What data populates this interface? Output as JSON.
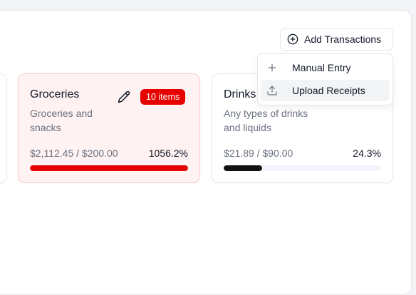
{
  "header": {
    "add_transactions_label": "Add Transactions",
    "add_icon": "plus-circle-icon"
  },
  "dropdown": {
    "items": [
      {
        "label": "Manual Entry",
        "icon": "plus-icon"
      },
      {
        "label": "Upload Receipts",
        "icon": "upload-icon",
        "highlighted": true
      }
    ]
  },
  "categories": [
    {
      "title": "Groceries",
      "description": "Groceries and snacks",
      "badge": "10 items",
      "amount": "$2,112.45 / $200.00",
      "percent_label": "1056.2%",
      "progress": 1.0,
      "bar_color": "#e60000",
      "over_budget": true
    },
    {
      "title": "Drinks",
      "description": "Any types of drinks and liquids",
      "amount": "$21.89 / $90.00",
      "percent_label": "24.3%",
      "progress": 0.243,
      "bar_color": "#111111",
      "over_budget": false
    }
  ],
  "colors": {
    "danger": "#e60000",
    "danger_bg": "#fef2f2",
    "text": "#111827",
    "muted": "#6b7280"
  }
}
